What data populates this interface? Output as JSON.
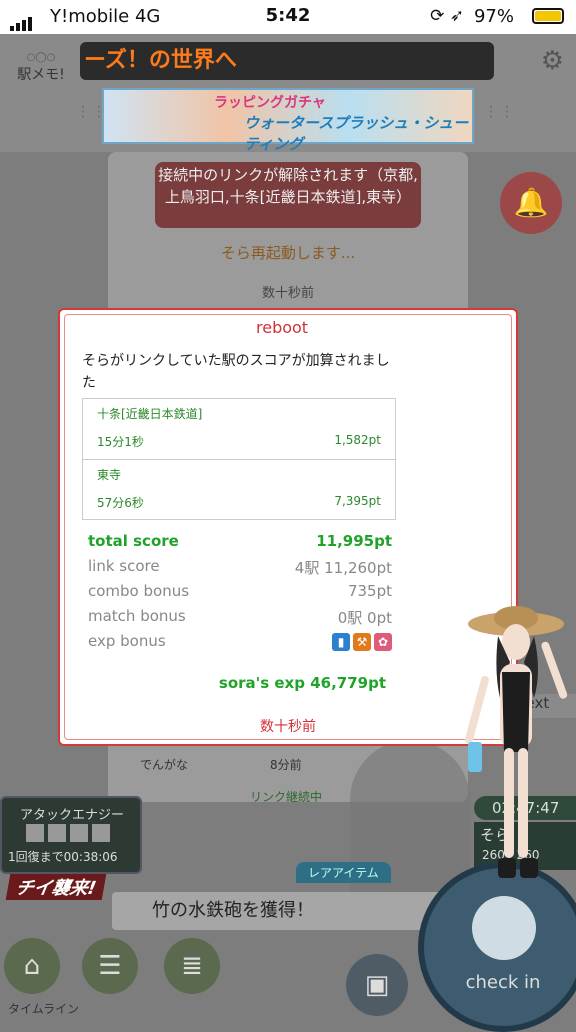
{
  "status_bar": {
    "carrier": "Y!mobile   4G",
    "time": "5:42",
    "battery": "97%"
  },
  "header": {
    "logo": "駅メモ!",
    "marquee": "ーズ！の世界へ"
  },
  "banner": {
    "line1": "ラッピングガチャ",
    "line2": "ウォータースプラッシュ・シューティング"
  },
  "background": {
    "alert": "接続中のリンクが解除されます（京都,上鳥羽口,十条[近畿日本鉄道],東寺）",
    "reboot_notice": "そら再起動します...",
    "time_ago": "数十秒前",
    "row_station": "でんがな",
    "row_time": "8分前",
    "link_status": "リンク継続中",
    "next": "next"
  },
  "dialog": {
    "title": "reboot",
    "message": "そらがリンクしていた駅のスコアが加算されました",
    "stations": [
      {
        "name": "十条[近畿日本鉄道]",
        "duration": "15分1秒",
        "points": "1,582pt"
      },
      {
        "name": "東寺",
        "duration": "57分6秒",
        "points": "7,395pt"
      }
    ],
    "scores": {
      "total": {
        "label": "total score",
        "value": "11,995pt"
      },
      "link": {
        "label": "link score",
        "value": "4駅 11,260pt"
      },
      "combo": {
        "label": "combo bonus",
        "value": "735pt"
      },
      "match": {
        "label": "match bonus",
        "value": "0駅 0pt"
      },
      "exp": {
        "label": "exp bonus"
      }
    },
    "exp_total": "sora's exp 46,779pt",
    "time_ago": "数十秒前"
  },
  "hud": {
    "attack_title": "アタックエナジー",
    "attack_recover": "1回復まで00:38:06",
    "chii": "チイ襲来!",
    "rare_item": "レアアイテム",
    "message": "竹の水鉄砲を獲得！",
    "timer": "02:47:47",
    "char_name": "そら",
    "char_hp": "260 / 260",
    "checkin": "check in",
    "timeline": "タイムライン"
  },
  "colors": {
    "accent_red": "#d3303a",
    "score_green": "#21a32a",
    "battery": "#f2c600"
  }
}
